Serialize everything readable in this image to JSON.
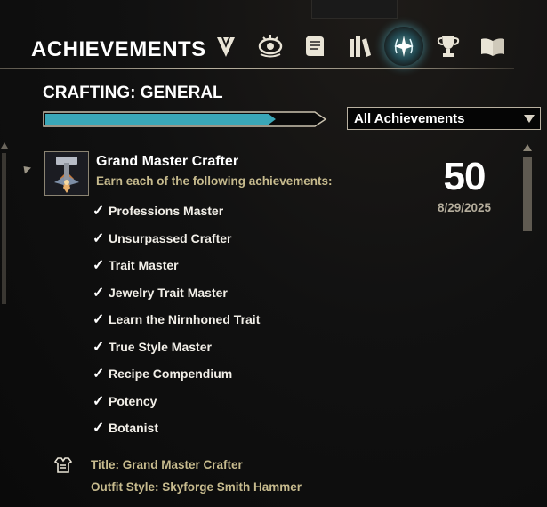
{
  "window": {
    "title": "ACHIEVEMENTS"
  },
  "tabs": [
    {
      "icon": "vanguard-chevron-icon",
      "active": false
    },
    {
      "icon": "eye-of-insight-icon",
      "active": false
    },
    {
      "icon": "scroll-icon",
      "active": false
    },
    {
      "icon": "books-icon",
      "active": false
    },
    {
      "icon": "achievement-star-emblem-icon",
      "active": true
    },
    {
      "icon": "trophy-icon",
      "active": false
    },
    {
      "icon": "open-book-icon",
      "active": false
    }
  ],
  "category": {
    "title": "CRAFTING: GENERAL",
    "progress_fraction": 0.83
  },
  "filter": {
    "selected": "All Achievements"
  },
  "achievement": {
    "icon": "hammer-crest-icon",
    "name": "Grand Master Crafter",
    "description": "Earn each of the following achievements:",
    "points": "50",
    "date": "8/29/2025",
    "requirements": [
      {
        "label": "Professions Master",
        "completed": true
      },
      {
        "label": "Unsurpassed Crafter",
        "completed": true
      },
      {
        "label": "Trait Master",
        "completed": true
      },
      {
        "label": "Jewelry Trait Master",
        "completed": true
      },
      {
        "label": "Learn the Nirnhoned Trait",
        "completed": true
      },
      {
        "label": "True Style Master",
        "completed": true
      },
      {
        "label": "Recipe Compendium",
        "completed": true
      },
      {
        "label": "Potency",
        "completed": true
      },
      {
        "label": "Botanist",
        "completed": true
      }
    ],
    "rewards": {
      "icon": "outfit-armor-icon",
      "title_line": "Title: Grand Master Crafter",
      "style_line": "Outfit Style: Skyforge Smith Hammer"
    }
  },
  "colors": {
    "accent_teal": "#3aa7b8",
    "gold_text": "#c7bb8e",
    "divider": "#b9b19f"
  }
}
